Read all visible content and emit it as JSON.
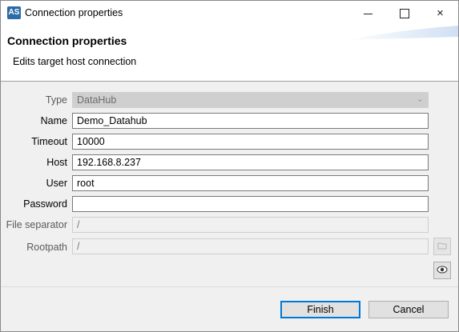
{
  "window": {
    "title": "Connection properties",
    "app_icon": "AS",
    "controls": {
      "minimize": "minimize-icon",
      "maximize": "maximize-icon",
      "close": "×"
    }
  },
  "header": {
    "title": "Connection properties",
    "description": "Edits target host connection"
  },
  "form": {
    "type": {
      "label": "Type",
      "value": "DataHub"
    },
    "name": {
      "label": "Name",
      "value": "Demo_Datahub"
    },
    "timeout": {
      "label": "Timeout",
      "value": "10000"
    },
    "host": {
      "label": "Host",
      "value": "192.168.8.237"
    },
    "user": {
      "label": "User",
      "value": "root"
    },
    "password": {
      "label": "Password",
      "value": ""
    },
    "file_separator": {
      "label": "File separator",
      "value": "/"
    },
    "rootpath": {
      "label": "Rootpath",
      "value": "/"
    }
  },
  "icons": {
    "browse": "folder-icon",
    "show_password": "eye-icon"
  },
  "buttons": {
    "finish": "Finish",
    "cancel": "Cancel"
  }
}
